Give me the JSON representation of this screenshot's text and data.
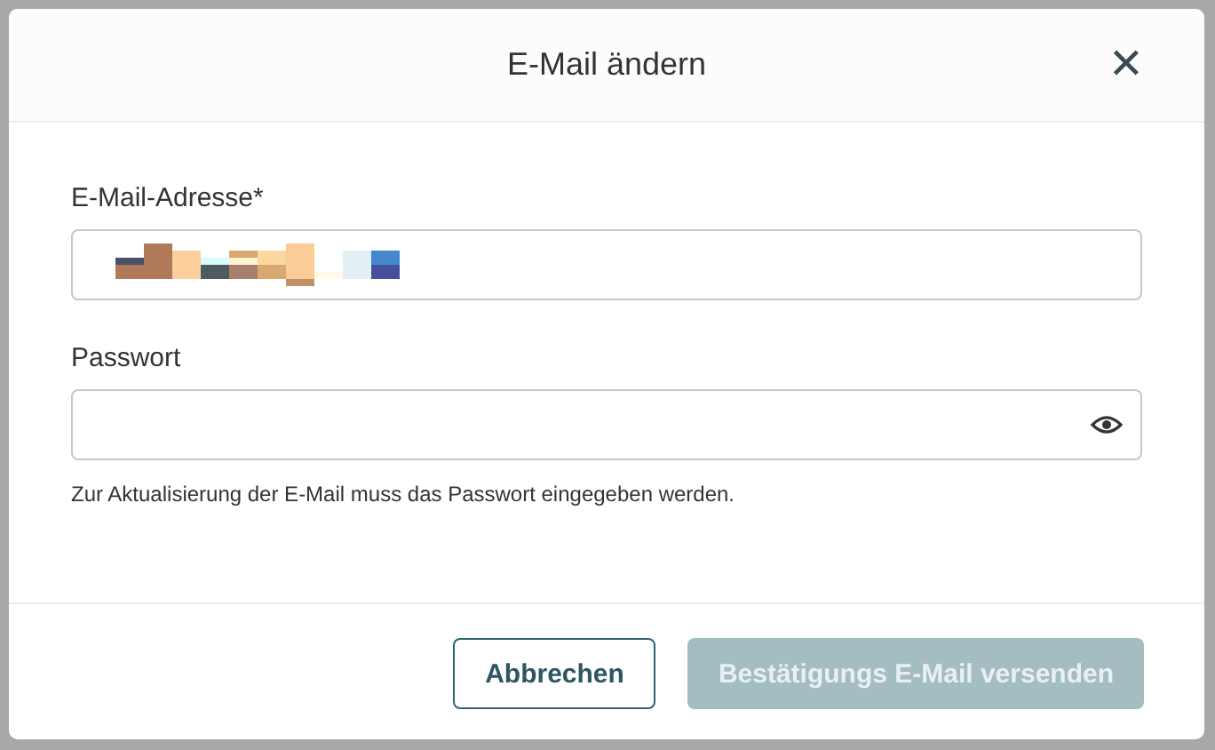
{
  "dialog": {
    "title": "E-Mail ändern",
    "close": "✕",
    "fields": [
      {
        "label": "E-Mail-Adresse*",
        "kind": "redacted"
      },
      {
        "label": "Passwort",
        "kind": "password",
        "hint": "Zur Aktualisierung der E-Mail muss das Passwort eingegeben werden."
      }
    ],
    "buttons": [
      {
        "label": "Abbrechen",
        "kind": "secondary",
        "disabled": false
      },
      {
        "label": "Bestätigungs E-Mail versenden",
        "kind": "primary",
        "disabled": true
      }
    ]
  }
}
